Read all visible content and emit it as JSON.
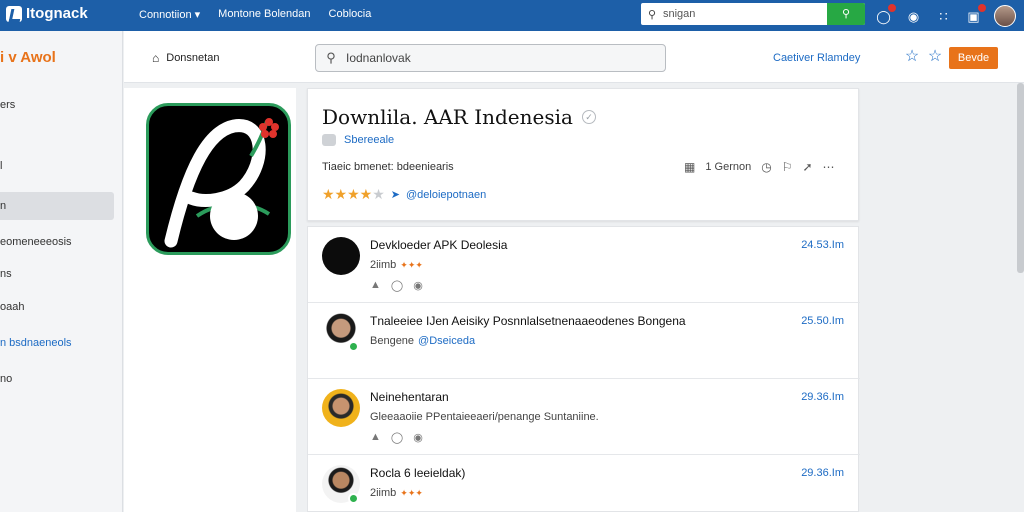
{
  "topbar": {
    "brand": "Itognack",
    "nav": [
      "Connotiion ▾",
      "Montone Bolendan",
      "Coblocia"
    ],
    "search_value": "snigan"
  },
  "sidebar": {
    "brand": "i v Awol",
    "items": [
      {
        "label": "ers",
        "active": false,
        "link": false
      },
      {
        "label": "l",
        "active": false,
        "link": false
      },
      {
        "label": "n",
        "active": true,
        "link": false
      },
      {
        "label": "eomeneeeosis",
        "active": false,
        "link": false
      },
      {
        "label": "ns",
        "active": false,
        "link": false
      },
      {
        "label": "oaah",
        "active": false,
        "link": false
      },
      {
        "label": "n bsdnaeneols",
        "active": false,
        "link": true
      },
      {
        "label": "no",
        "active": false,
        "link": false
      }
    ]
  },
  "subheader": {
    "home_label": "Donsnetan",
    "search_value": "Iodnanlovak",
    "category_link": "Caetiver Rlamdey",
    "primary_button": "Bevde"
  },
  "app": {
    "title": "Downlila. AAR Indenesia",
    "developer": "Sbereeale",
    "subtitle": "Tiaeic bmenet: bdeeniearis",
    "rating": 4,
    "rating_handle": "@deloiepotnaen",
    "count_label": "1 Gernon"
  },
  "comments": [
    {
      "name": "Devkloeder APK Deolesia",
      "meta": "2iimb",
      "tag": "✦✦✦",
      "time": "24.53.Im",
      "avatar": "dark",
      "online": false
    },
    {
      "name": "Tnaleeiee IJen Aeisiky Posnnlalsetnenaaeodenes Bongena",
      "meta": "Bengene",
      "handle": "@Dseiceda",
      "time": "25.50.Im",
      "avatar": "photo1",
      "online": true
    },
    {
      "name": "Neinehentaran",
      "meta": "Gleeaaoiie PPentaieeaeri/penange Suntaniine.",
      "time": "29.36.Im",
      "avatar": "photo2",
      "online": false
    },
    {
      "name": "Rocla 6 leeieldak)",
      "meta": "2iimb",
      "tag": "✦✦✦",
      "time": "29.36.Im",
      "avatar": "photo3",
      "online": true
    }
  ],
  "colors": {
    "nav_blue": "#1d5fa8",
    "accent_orange": "#e8731a",
    "link_blue": "#1d6bc4",
    "icon_green": "#2b9b5b"
  },
  "icons": [
    "search-icon",
    "bell-icon",
    "compass-icon",
    "grid-icon",
    "notifications-icon",
    "home-icon",
    "star-outline-icon",
    "share-icon",
    "more-icon",
    "like-icon",
    "comment-icon",
    "reply-icon"
  ]
}
